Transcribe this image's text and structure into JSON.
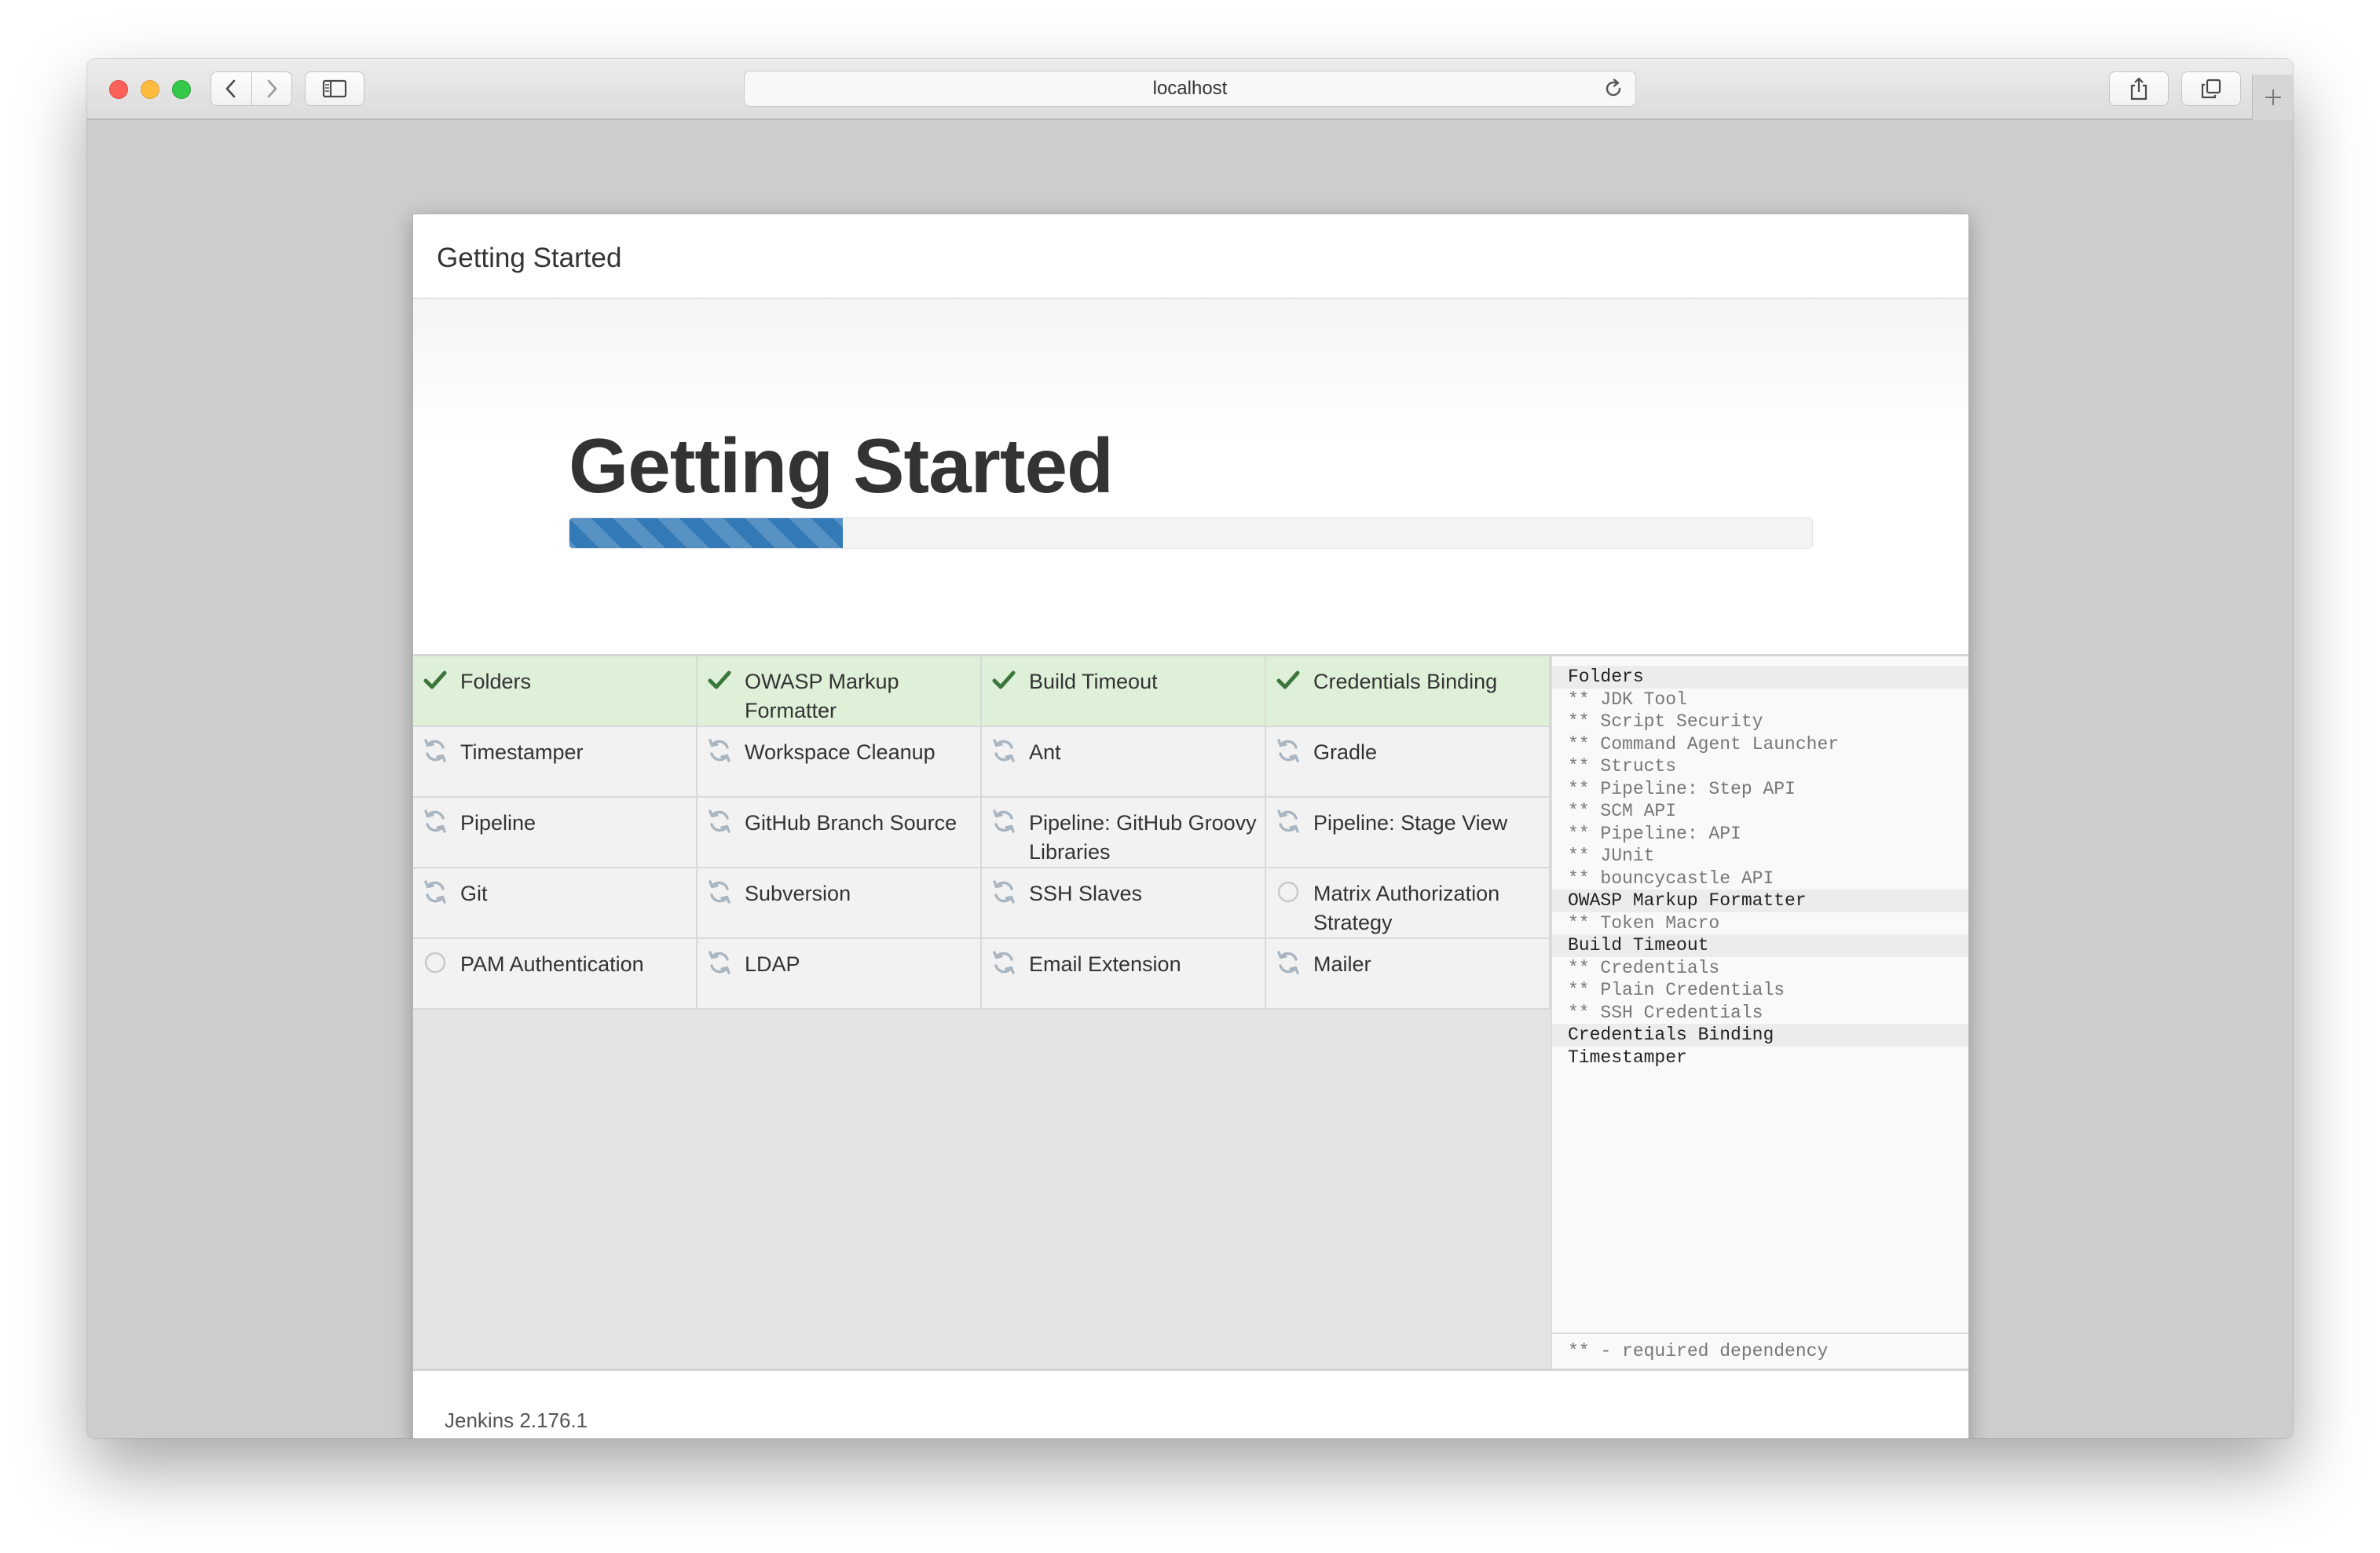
{
  "browser": {
    "address": "localhost",
    "icons": {
      "back": "chevron-left-icon",
      "forward": "chevron-right-icon",
      "sidebar": "sidebar-icon",
      "reload": "reload-icon",
      "share": "share-icon",
      "tabs": "tabs-overview-icon",
      "new_tab": "plus-icon"
    }
  },
  "dialog": {
    "header_title": "Getting Started",
    "hero_title": "Getting Started",
    "progress_percent": 22,
    "footer_version": "Jenkins 2.176.1"
  },
  "plugins": [
    {
      "name": "Folders",
      "status": "success"
    },
    {
      "name": "OWASP Markup Formatter",
      "status": "success"
    },
    {
      "name": "Build Timeout",
      "status": "success"
    },
    {
      "name": "Credentials Binding",
      "status": "success"
    },
    {
      "name": "Timestamper",
      "status": "installing"
    },
    {
      "name": "Workspace Cleanup",
      "status": "installing"
    },
    {
      "name": "Ant",
      "status": "installing"
    },
    {
      "name": "Gradle",
      "status": "installing"
    },
    {
      "name": "Pipeline",
      "status": "installing"
    },
    {
      "name": "GitHub Branch Source",
      "status": "installing"
    },
    {
      "name": "Pipeline: GitHub Groovy Libraries",
      "status": "installing"
    },
    {
      "name": "Pipeline: Stage View",
      "status": "installing"
    },
    {
      "name": "Git",
      "status": "installing"
    },
    {
      "name": "Subversion",
      "status": "installing"
    },
    {
      "name": "SSH Slaves",
      "status": "installing"
    },
    {
      "name": "Matrix Authorization Strategy",
      "status": "pending"
    },
    {
      "name": "PAM Authentication",
      "status": "pending"
    },
    {
      "name": "LDAP",
      "status": "installing"
    },
    {
      "name": "Email Extension",
      "status": "installing"
    },
    {
      "name": "Mailer",
      "status": "installing"
    }
  ],
  "log": {
    "entries": [
      {
        "text": "Folders",
        "kind": "plugin"
      },
      {
        "text": "** JDK Tool",
        "kind": "dep"
      },
      {
        "text": "** Script Security",
        "kind": "dep"
      },
      {
        "text": "** Command Agent Launcher",
        "kind": "dep"
      },
      {
        "text": "** Structs",
        "kind": "dep"
      },
      {
        "text": "** Pipeline: Step API",
        "kind": "dep"
      },
      {
        "text": "** SCM API",
        "kind": "dep"
      },
      {
        "text": "** Pipeline: API",
        "kind": "dep"
      },
      {
        "text": "** JUnit",
        "kind": "dep"
      },
      {
        "text": "** bouncycastle API",
        "kind": "dep"
      },
      {
        "text": "OWASP Markup Formatter",
        "kind": "plugin"
      },
      {
        "text": "** Token Macro",
        "kind": "dep"
      },
      {
        "text": "Build Timeout",
        "kind": "plugin"
      },
      {
        "text": "** Credentials",
        "kind": "dep"
      },
      {
        "text": "** Plain Credentials",
        "kind": "dep"
      },
      {
        "text": "** SSH Credentials",
        "kind": "dep"
      },
      {
        "text": "Credentials Binding",
        "kind": "plugin"
      },
      {
        "text": "Timestamper",
        "kind": "plain"
      }
    ],
    "legend": "** - required dependency"
  },
  "colors": {
    "success_bg": "#dff0d8",
    "success_check": "#3c763d",
    "installing_icon": "#a9b6c2",
    "pending_icon": "#c8c8c8",
    "progress_fill": "#337ab7"
  }
}
